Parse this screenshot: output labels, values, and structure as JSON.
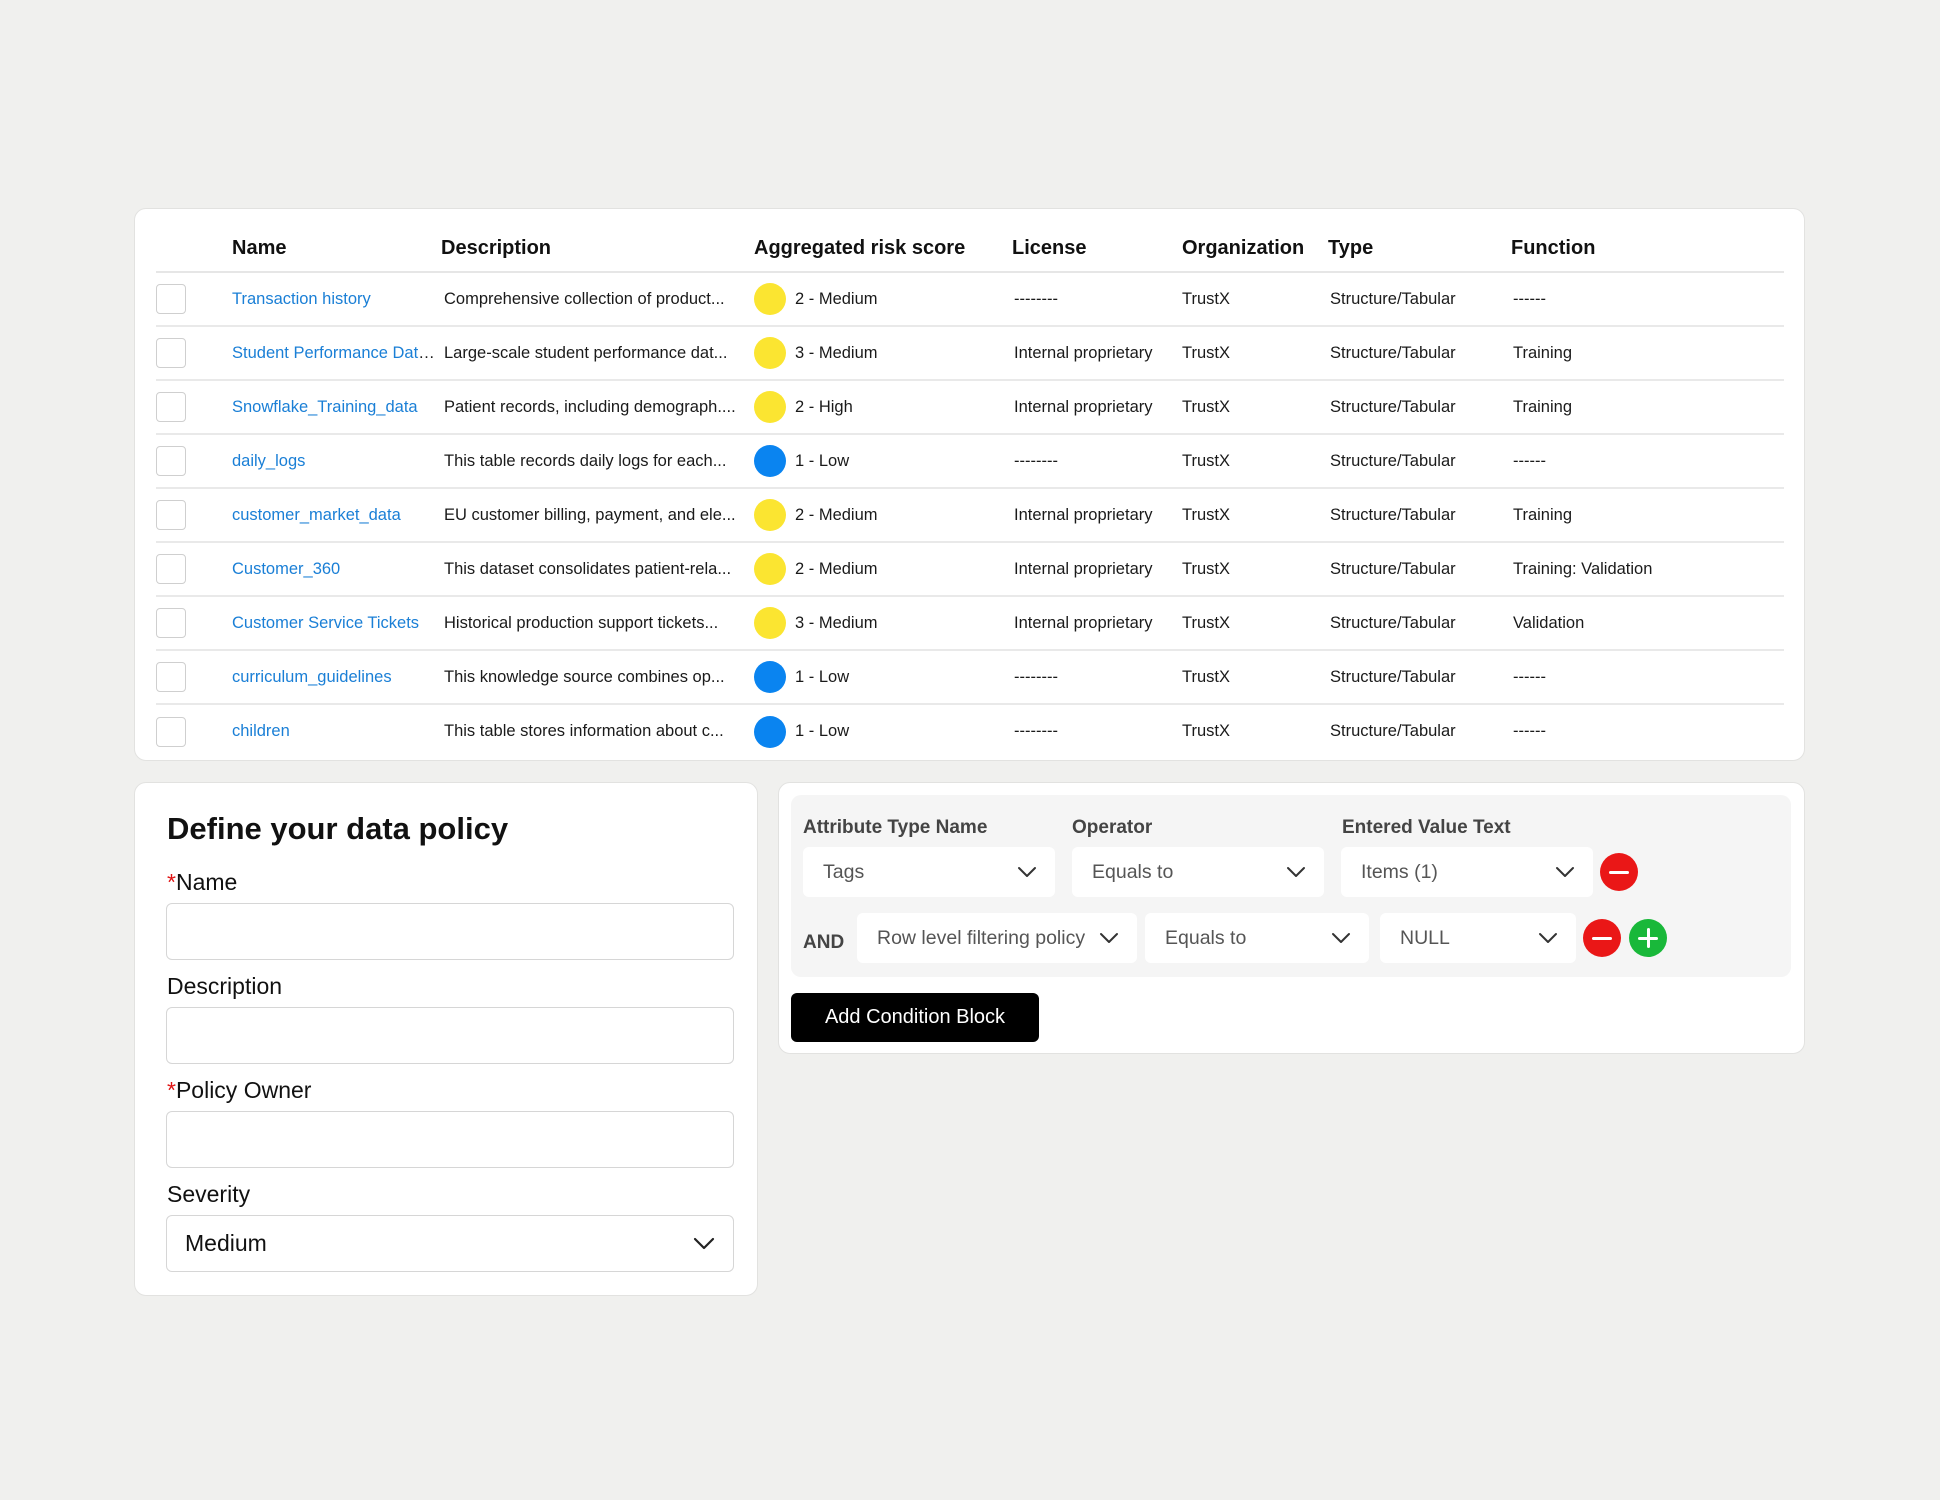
{
  "table": {
    "headers": {
      "name": "Name",
      "description": "Description",
      "risk": "Aggregated risk score",
      "license": "License",
      "organization": "Organization",
      "type": "Type",
      "function": "Function"
    },
    "colors": {
      "medium_high": "#fbe531",
      "low": "#0a84f0",
      "link": "#1a7fd6"
    },
    "rows": [
      {
        "name": "Transaction history",
        "description": "Comprehensive collection of product...",
        "risk": "2 - Medium",
        "risk_level": "yellow",
        "license": "--------",
        "organization": "TrustX",
        "type": "Structure/Tabular",
        "function": "------"
      },
      {
        "name": "Student Performance Dataset",
        "description": "Large-scale student performance dat...",
        "risk": "3 - Medium",
        "risk_level": "yellow",
        "license": "Internal proprietary",
        "organization": "TrustX",
        "type": "Structure/Tabular",
        "function": "Training"
      },
      {
        "name": "Snowflake_Training_data",
        "description": "Patient records, including demograph....",
        "risk": "2 - High",
        "risk_level": "yellow",
        "license": "Internal proprietary",
        "organization": "TrustX",
        "type": "Structure/Tabular",
        "function": "Training"
      },
      {
        "name": "daily_logs",
        "description": "This table records daily logs for each...",
        "risk": "1 - Low",
        "risk_level": "blue",
        "license": "--------",
        "organization": "TrustX",
        "type": "Structure/Tabular",
        "function": "------"
      },
      {
        "name": "customer_market_data",
        "description": "EU customer billing, payment, and ele...",
        "risk": "2 - Medium",
        "risk_level": "yellow",
        "license": "Internal proprietary",
        "organization": "TrustX",
        "type": "Structure/Tabular",
        "function": "Training"
      },
      {
        "name": "Customer_360",
        "description": "This dataset consolidates patient-rela...",
        "risk": "2 - Medium",
        "risk_level": "yellow",
        "license": "Internal proprietary",
        "organization": "TrustX",
        "type": "Structure/Tabular",
        "function": "Training: Validation"
      },
      {
        "name": "Customer Service Tickets",
        "description": "Historical production support tickets...",
        "risk": "3 - Medium",
        "risk_level": "yellow",
        "license": "Internal proprietary",
        "organization": "TrustX",
        "type": "Structure/Tabular",
        "function": "Validation"
      },
      {
        "name": "curriculum_guidelines",
        "description": "This knowledge source combines op...",
        "risk": "1 - Low",
        "risk_level": "blue",
        "license": "--------",
        "organization": "TrustX",
        "type": "Structure/Tabular",
        "function": "------"
      },
      {
        "name": "children",
        "description": "This table stores information about c...",
        "risk": "1 - Low",
        "risk_level": "blue",
        "license": "--------",
        "organization": "TrustX",
        "type": "Structure/Tabular",
        "function": "------"
      }
    ]
  },
  "policy_form": {
    "title": "Define your data policy",
    "required_mark": "*",
    "name_label": "Name",
    "name_value": "",
    "description_label": "Description",
    "description_value": "",
    "owner_label": "Policy Owner",
    "owner_value": "",
    "severity_label": "Severity",
    "severity_value": "Medium"
  },
  "conditions": {
    "headers": {
      "attribute": "Attribute Type Name",
      "operator": "Operator",
      "value": "Entered Value Text"
    },
    "row1": {
      "attribute": "Tags",
      "operator": "Equals to",
      "value": "Items (1)"
    },
    "and_label": "AND",
    "row2": {
      "attribute": "Row level filtering policy",
      "operator": "Equals to",
      "value": "NULL"
    },
    "add_button": "Add Condition Block",
    "colors": {
      "remove": "#ea1717",
      "add": "#19b83a"
    }
  }
}
